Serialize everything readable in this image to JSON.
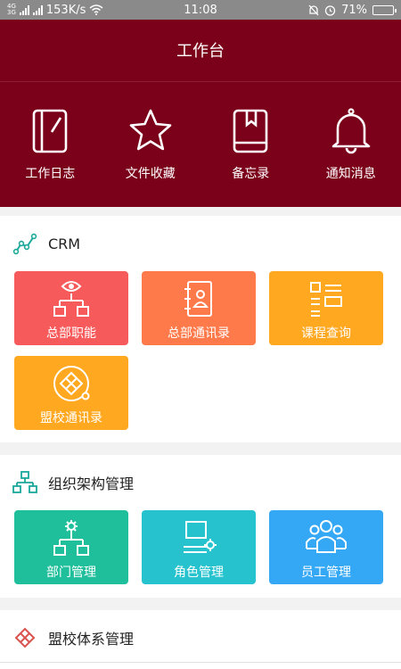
{
  "status_bar": {
    "network_top": "4G",
    "network_bottom": "3G",
    "speed": "153K/s",
    "time": "11:08",
    "battery": "71%",
    "battery_level": 0.71
  },
  "header": {
    "title": "工作台",
    "quick_items": [
      {
        "label": "工作日志",
        "icon": "notebook-icon"
      },
      {
        "label": "文件收藏",
        "icon": "star-icon"
      },
      {
        "label": "备忘录",
        "icon": "bookmark-book-icon"
      },
      {
        "label": "通知消息",
        "icon": "bell-icon"
      }
    ]
  },
  "sections": {
    "crm": {
      "title": "CRM",
      "tiles": [
        {
          "label": "总部职能",
          "icon": "eye-org-icon",
          "color": "#f75a5a"
        },
        {
          "label": "总部通讯录",
          "icon": "contact-book-icon",
          "color": "#ff7a4a"
        },
        {
          "label": "课程查询",
          "icon": "list-grid-icon",
          "color": "#ffa820"
        },
        {
          "label": "盟校通讯录",
          "icon": "diamond-logo-icon",
          "color": "#ffa820"
        }
      ]
    },
    "org": {
      "title": "组织架构管理",
      "tiles": [
        {
          "label": "部门管理",
          "icon": "gear-org-icon",
          "color": "#1fbf9b"
        },
        {
          "label": "角色管理",
          "icon": "monitor-gear-icon",
          "color": "#26c3cf"
        },
        {
          "label": "员工管理",
          "icon": "people-icon",
          "color": "#35a8f5"
        }
      ]
    },
    "league": {
      "title": "盟校体系管理"
    }
  },
  "colors": {
    "brand": "#7b0019",
    "status_bar": "#8a8a8a"
  }
}
